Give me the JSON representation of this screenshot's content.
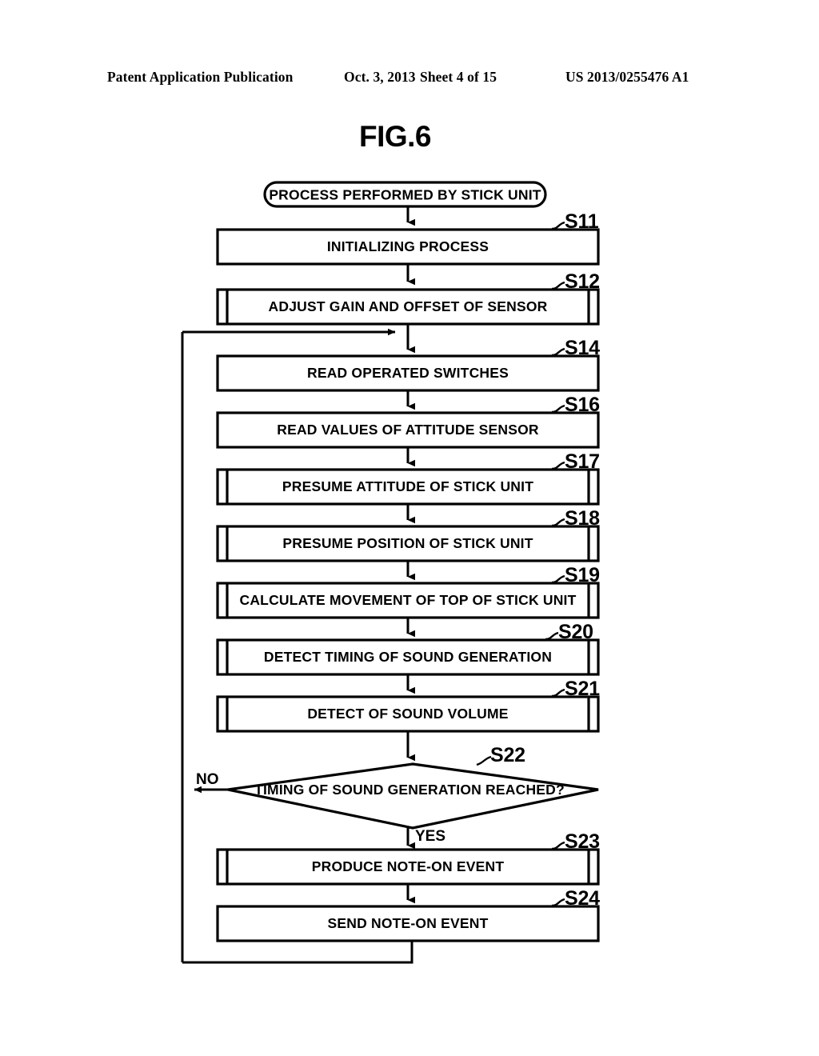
{
  "header": {
    "publication": "Patent Application Publication",
    "date": "Oct. 3, 2013",
    "sheet": "Sheet 4 of 15",
    "number": "US 2013/0255476 A1"
  },
  "figure": {
    "title": "FIG.6"
  },
  "flowchart": {
    "start": {
      "step": "",
      "label": "PROCESS PERFORMED BY STICK UNIT",
      "shape": "terminator"
    },
    "nodes": [
      {
        "step": "S11",
        "label": "INITIALIZING PROCESS",
        "shape": "process"
      },
      {
        "step": "S12",
        "label": "ADJUST GAIN AND OFFSET OF SENSOR",
        "shape": "predefined-process"
      },
      {
        "step": "S14",
        "label": "READ OPERATED SWITCHES",
        "shape": "process"
      },
      {
        "step": "S16",
        "label": "READ VALUES OF ATTITUDE SENSOR",
        "shape": "process"
      },
      {
        "step": "S17",
        "label": "PRESUME ATTITUDE OF STICK UNIT",
        "shape": "predefined-process"
      },
      {
        "step": "S18",
        "label": "PRESUME POSITION OF STICK UNIT",
        "shape": "predefined-process"
      },
      {
        "step": "S19",
        "label": "CALCULATE MOVEMENT OF TOP OF STICK UNIT",
        "shape": "predefined-process"
      },
      {
        "step": "S20",
        "label": "DETECT TIMING OF SOUND GENERATION",
        "shape": "predefined-process"
      },
      {
        "step": "S21",
        "label": "DETECT OF SOUND VOLUME",
        "shape": "predefined-process"
      },
      {
        "step": "S22",
        "label": "TIMING OF SOUND GENERATION REACHED?",
        "shape": "decision"
      },
      {
        "step": "S23",
        "label": "PRODUCE NOTE-ON EVENT",
        "shape": "predefined-process"
      },
      {
        "step": "S24",
        "label": "SEND NOTE-ON EVENT",
        "shape": "process"
      }
    ],
    "branches": {
      "no": "NO",
      "yes": "YES"
    }
  }
}
